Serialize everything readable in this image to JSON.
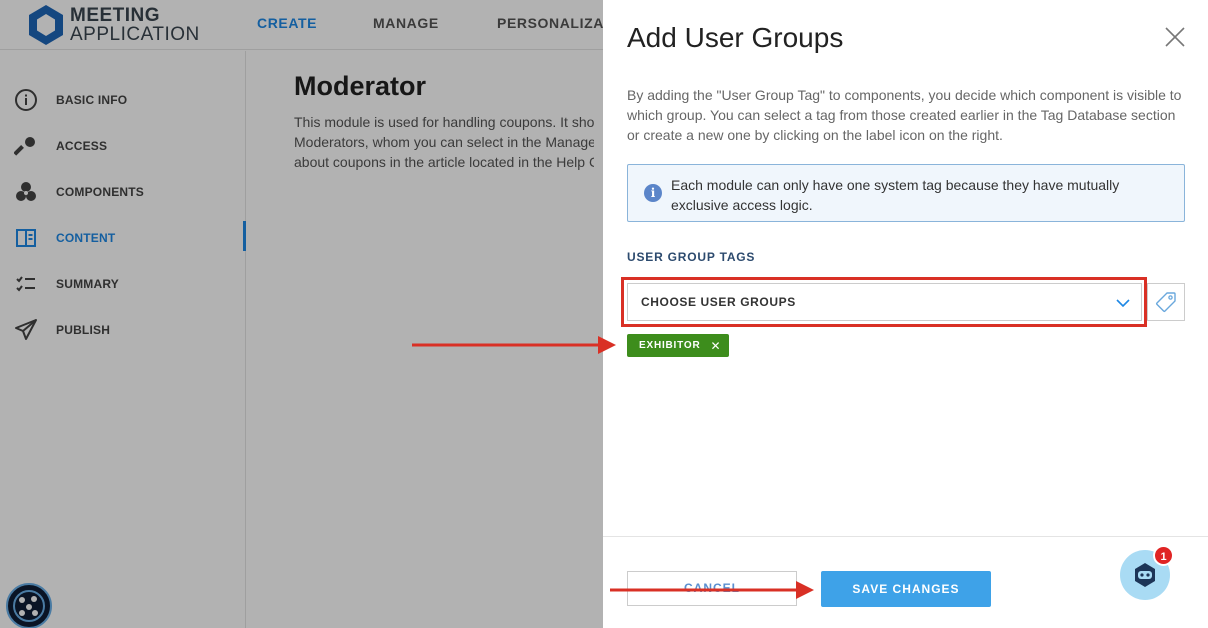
{
  "app": {
    "logo_line1": "MEETING",
    "logo_line2": "APPLICATION"
  },
  "topnav": [
    {
      "label": "CREATE",
      "active": true
    },
    {
      "label": "MANAGE",
      "active": false
    },
    {
      "label": "PERSONALIZAT",
      "active": false
    }
  ],
  "sidebar": {
    "items": [
      {
        "label": "BASIC INFO",
        "icon": "info-icon"
      },
      {
        "label": "ACCESS",
        "icon": "key-icon"
      },
      {
        "label": "COMPONENTS",
        "icon": "components-icon"
      },
      {
        "label": "CONTENT",
        "icon": "content-icon",
        "active": true
      },
      {
        "label": "SUMMARY",
        "icon": "checklist-icon"
      },
      {
        "label": "PUBLISH",
        "icon": "send-icon"
      }
    ]
  },
  "main": {
    "title": "Moderator",
    "desc_line1": "This module is used for handling coupons. It should",
    "desc_line2": "Moderators, whom you can select in the Manage/Pa",
    "desc_line3": "about coupons in the article located in the Help Cen"
  },
  "modal": {
    "title": "Add User Groups",
    "description": "By adding the \"User Group Tag\" to components, you decide which component is visible to which group. You can select a tag from those created earlier in the Tag Database section or create a new one by clicking on the label icon on the right.",
    "info_text": "Each module can only have one system tag because they have mutually exclusive access logic.",
    "info_icon_glyph": "i",
    "section_label": "USER GROUP TAGS",
    "select_placeholder": "CHOOSE USER GROUPS",
    "chip_label": "EXHIBITOR",
    "cancel_label": "CANCEL",
    "save_label": "SAVE CHANGES",
    "chat_badge": "1"
  },
  "colors": {
    "accent": "#1e88e5",
    "chip": "#3d8d1c",
    "save_button": "#3ea2e8",
    "annotation_red": "#d93025"
  }
}
